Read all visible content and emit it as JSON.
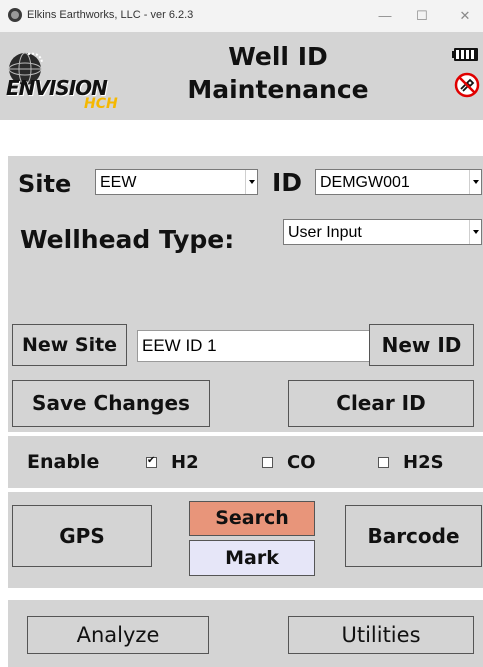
{
  "window": {
    "title": "Elkins Earthworks, LLC - ver 6.2.3",
    "minimize_glyph": "—",
    "maximize_glyph": "☐",
    "close_glyph": "✕"
  },
  "header": {
    "logo_text": "ENVISION",
    "logo_sub": "HCH",
    "title_line1": "Well ID",
    "title_line2": "Maintenance",
    "icons": [
      "battery-icon",
      "no-signal-icon"
    ]
  },
  "site_row": {
    "site_label": "Site",
    "site_value": "EEW",
    "id_label": "ID",
    "id_value": "DEMGW001"
  },
  "wellhead": {
    "label": "Wellhead Type:",
    "value": "User Input"
  },
  "new_row": {
    "new_site_label": "New Site",
    "input_value": "EEW ID 1",
    "new_id_label": "New ID"
  },
  "actions": {
    "save_label": "Save Changes",
    "clear_label": "Clear ID"
  },
  "enable": {
    "label": "Enable",
    "options": [
      {
        "label": "H2",
        "checked": true
      },
      {
        "label": "CO",
        "checked": false
      },
      {
        "label": "H2S",
        "checked": false
      }
    ]
  },
  "tools": {
    "gps_label": "GPS",
    "search_label": "Search",
    "mark_label": "Mark",
    "barcode_label": "Barcode",
    "search_color": "#e8957a",
    "mark_color": "#e6e6f8"
  },
  "footer": {
    "analyze_label": "Analyze",
    "utilities_label": "Utilities"
  }
}
